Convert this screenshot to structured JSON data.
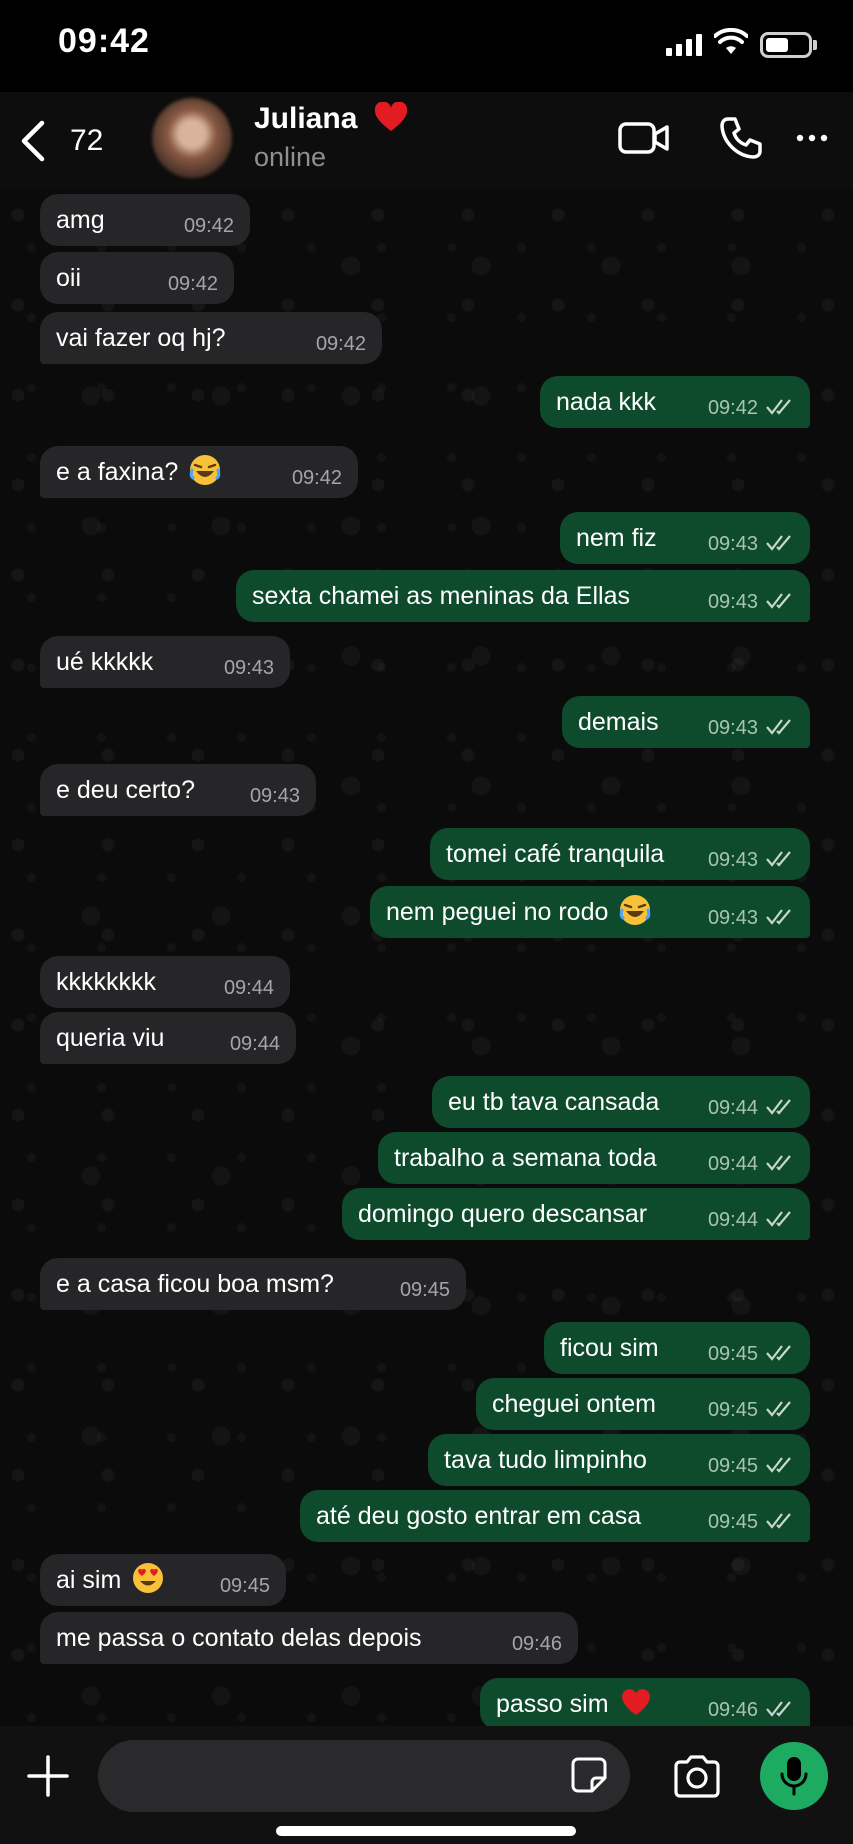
{
  "status_bar": {
    "time": "09:42"
  },
  "header": {
    "back_count": "72",
    "contact_name": "Juliana",
    "contact_status": "online"
  },
  "messages": [
    {
      "text": "amg",
      "time": "09:42"
    },
    {
      "text": "oii",
      "time": "09:42"
    },
    {
      "text": "vai fazer oq hj?",
      "time": "09:42"
    },
    {
      "text": "nada kkk",
      "time": "09:42"
    },
    {
      "text": "e a faxina?",
      "time": "09:42"
    },
    {
      "text": "nem fiz",
      "time": "09:43"
    },
    {
      "text": "sexta chamei as meninas da Ellas",
      "time": "09:43"
    },
    {
      "text": "ué kkkkk",
      "time": "09:43"
    },
    {
      "text": "demais",
      "time": "09:43"
    },
    {
      "text": "e deu certo?",
      "time": "09:43"
    },
    {
      "text": "tomei café tranquila",
      "time": "09:43"
    },
    {
      "text": "nem peguei no rodo",
      "time": "09:43"
    },
    {
      "text": "kkkkkkkk",
      "time": "09:44"
    },
    {
      "text": "queria viu",
      "time": "09:44"
    },
    {
      "text": "eu tb tava cansada",
      "time": "09:44"
    },
    {
      "text": "trabalho a semana toda",
      "time": "09:44"
    },
    {
      "text": "domingo quero descansar",
      "time": "09:44"
    },
    {
      "text": "e a casa ficou boa msm?",
      "time": "09:45"
    },
    {
      "text": "ficou sim",
      "time": "09:45"
    },
    {
      "text": "cheguei ontem",
      "time": "09:45"
    },
    {
      "text": "tava tudo limpinho",
      "time": "09:45"
    },
    {
      "text": "até deu gosto entrar em casa",
      "time": "09:45"
    },
    {
      "text": "ai sim",
      "time": "09:45"
    },
    {
      "text": "me passa o contato delas depois",
      "time": "09:46"
    },
    {
      "text": "passo sim",
      "time": "09:46"
    }
  ],
  "composer": {
    "value": ""
  },
  "colors": {
    "incoming_bubble": "#262628",
    "outgoing_bubble": "#0e4b2c",
    "mic_button": "#1daa61"
  },
  "icons": [
    "back-chevron-icon",
    "heart-icon",
    "video-call-icon",
    "phone-icon",
    "more-icon",
    "read-ticks-icon",
    "laughing-emoji-icon",
    "heart-eyes-emoji-icon",
    "plus-icon",
    "sticker-icon",
    "camera-icon",
    "microphone-icon"
  ]
}
